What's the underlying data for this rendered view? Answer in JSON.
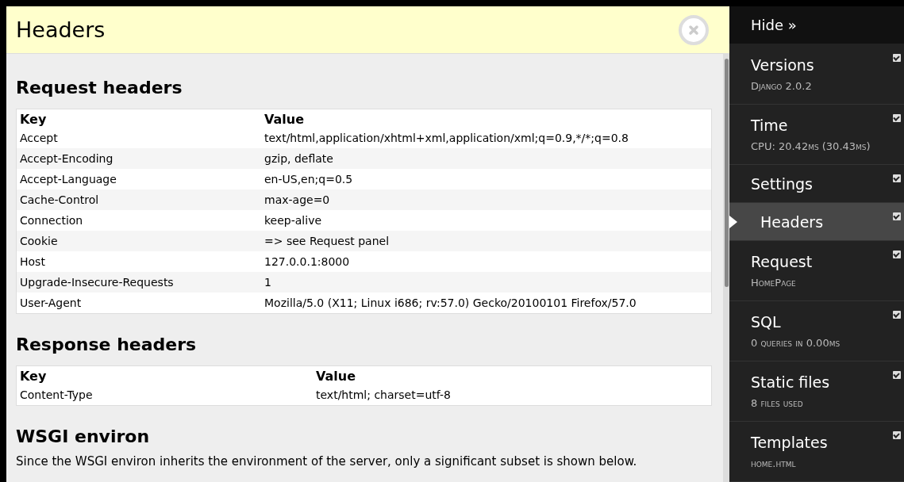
{
  "panel": {
    "title": "Headers",
    "sections": [
      {
        "heading": "Request headers",
        "columns": [
          "Key",
          "Value"
        ],
        "rows": [
          [
            "Accept",
            "text/html,application/xhtml+xml,application/xml;q=0.9,*/*;q=0.8"
          ],
          [
            "Accept-Encoding",
            "gzip, deflate"
          ],
          [
            "Accept-Language",
            "en-US,en;q=0.5"
          ],
          [
            "Cache-Control",
            "max-age=0"
          ],
          [
            "Connection",
            "keep-alive"
          ],
          [
            "Cookie",
            "=> see Request panel"
          ],
          [
            "Host",
            "127.0.0.1:8000"
          ],
          [
            "Upgrade-Insecure-Requests",
            "1"
          ],
          [
            "User-Agent",
            "Mozilla/5.0 (X11; Linux i686; rv:57.0) Gecko/20100101 Firefox/57.0"
          ]
        ]
      },
      {
        "heading": "Response headers",
        "columns": [
          "Key",
          "Value"
        ],
        "rows": [
          [
            "Content-Type",
            "text/html; charset=utf-8"
          ]
        ]
      },
      {
        "heading": "WSGI environ",
        "paragraph": "Since the WSGI environ inherits the environment of the server, only a significant subset is shown below."
      }
    ]
  },
  "toolbar": {
    "hide_label": "Hide »",
    "items": [
      {
        "title": "Versions",
        "subtitle": "Django 2.0.2",
        "checked": true,
        "selected": false
      },
      {
        "title": "Time",
        "subtitle": "CPU: 20.42ms (30.43ms)",
        "checked": true,
        "selected": false
      },
      {
        "title": "Settings",
        "checked": true,
        "selected": false
      },
      {
        "title": "Headers",
        "checked": true,
        "selected": true
      },
      {
        "title": "Request",
        "subtitle": "HomePage",
        "checked": true,
        "selected": false
      },
      {
        "title": "SQL",
        "subtitle": "0 queries in 0.00ms",
        "checked": true,
        "selected": false
      },
      {
        "title": "Static files",
        "subtitle": "8 files used",
        "checked": true,
        "selected": false
      },
      {
        "title": "Templates",
        "subtitle": "home.html",
        "checked": true,
        "selected": false
      }
    ]
  }
}
